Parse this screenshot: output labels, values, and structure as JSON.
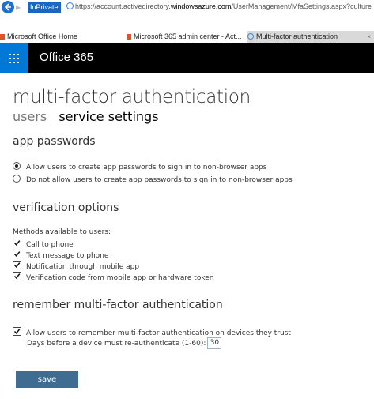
{
  "browser": {
    "inprivate_label": "InPrivate",
    "url_prefix": "https://account.activedirectory.",
    "url_host": "windowsazure.com",
    "url_path": "/UserManagement/MfaSettings.aspx?culture",
    "tabs": [
      {
        "label": "Microsoft Office Home",
        "active": false
      },
      {
        "label": "Microsoft 365 admin center - Act...",
        "active": false
      },
      {
        "label": "Multi-factor authentication",
        "active": true,
        "close": "×"
      }
    ]
  },
  "header": {
    "brand": "Office 365"
  },
  "page": {
    "title": "multi-factor authentication",
    "nav": {
      "users": "users",
      "service_settings": "service settings"
    }
  },
  "app_passwords": {
    "title": "app passwords",
    "options": [
      {
        "label": "Allow users to create app passwords to sign in to non-browser apps",
        "selected": true
      },
      {
        "label": "Do not allow users to create app passwords to sign in to non-browser apps",
        "selected": false
      }
    ]
  },
  "verification": {
    "title": "verification options",
    "methods_label": "Methods available to users:",
    "methods": [
      {
        "label": "Call to phone",
        "checked": true
      },
      {
        "label": "Text message to phone",
        "checked": true
      },
      {
        "label": "Notification through mobile app",
        "checked": true
      },
      {
        "label": "Verification code from mobile app or hardware token",
        "checked": true
      }
    ]
  },
  "remember": {
    "title": "remember multi-factor authentication",
    "allow_label": "Allow users to remember multi-factor authentication on devices they trust",
    "allow_checked": true,
    "days_label": "Days before a device must re-authenticate (1-60):",
    "days_value": "30"
  },
  "actions": {
    "save_label": "save"
  },
  "colors": {
    "header_bg": "#000000",
    "waffle_bg": "#0078d7",
    "save_bg": "#3f6c91",
    "inprivate_bg": "#1767c5"
  }
}
